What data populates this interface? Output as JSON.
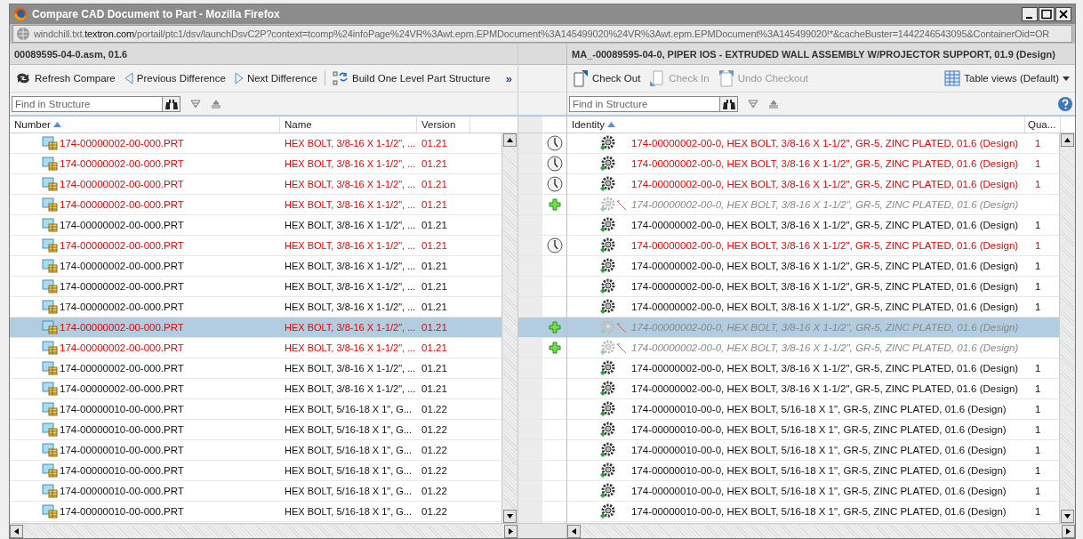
{
  "window": {
    "title": "Compare CAD Document to Part - Mozilla Firefox"
  },
  "address_bar": {
    "url_prefix": "windchill.txt.",
    "url_host": "textron.com",
    "url_rest": "/portail/ptc1/dsv/launchDsvC2P?context=tcomp%24infoPage%24VR%3Awt.epm.EPMDocument%3A145499020%24VR%3Awt.epm.EPMDocument%3A145499020!*&cacheBuster=1442246543095&ContainerOid=OR"
  },
  "left_pane": {
    "title": "00089595-04-0.asm, 01.6",
    "toolbar": [
      {
        "kind": "refresh",
        "label": "Refresh Compare"
      },
      {
        "kind": "previous",
        "label": "Previous Difference"
      },
      {
        "kind": "next",
        "label": "Next Difference"
      },
      {
        "kind": "build",
        "label": "Build One Level Part Structure"
      }
    ],
    "overflow": "»",
    "search": {
      "placeholder": "Find in Structure"
    },
    "columns": [
      {
        "label": "Number",
        "sorted": true
      },
      {
        "label": "Name",
        "sorted": false
      },
      {
        "label": "Version",
        "sorted": false
      }
    ]
  },
  "right_pane": {
    "title": "MA_-00089595-04-0, PIPER IOS - EXTRUDED WALL ASSEMBLY W/PROJECTOR SUPPORT, 01.9 (Design)",
    "toolbar": [
      {
        "kind": "checkout",
        "label": "Check Out",
        "disabled": false
      },
      {
        "kind": "checkin",
        "label": "Check In",
        "disabled": true
      },
      {
        "kind": "undo",
        "label": "Undo Checkout",
        "disabled": true
      }
    ],
    "table_views": "Table views (Default)",
    "search": {
      "placeholder": "Find in Structure"
    },
    "columns": [
      {
        "label": "Identity",
        "sorted": true
      },
      {
        "label": "Qua...",
        "sorted": false
      }
    ]
  },
  "rows": [
    {
      "selected": false,
      "compare": {
        "kind": "modified"
      },
      "left": {
        "number": "174-00000002-00-000.PRT",
        "name": "HEX BOLT, 3/8-16 X 1-1/2\", ...",
        "version": "01.21",
        "changed": true
      },
      "right": {
        "identity": "174-00000002-00-0, HEX BOLT, 3/8-16 X 1-1/2\", GR-5, ZINC PLATED, 01.6 (Design)",
        "quantity": "1",
        "changed": true,
        "missing": false
      }
    },
    {
      "selected": false,
      "compare": {
        "kind": "modified"
      },
      "left": {
        "number": "174-00000002-00-000.PRT",
        "name": "HEX BOLT, 3/8-16 X 1-1/2\", ...",
        "version": "01.21",
        "changed": true
      },
      "right": {
        "identity": "174-00000002-00-0, HEX BOLT, 3/8-16 X 1-1/2\", GR-5, ZINC PLATED, 01.6 (Design)",
        "quantity": "1",
        "changed": true,
        "missing": false
      }
    },
    {
      "selected": false,
      "compare": {
        "kind": "modified"
      },
      "left": {
        "number": "174-00000002-00-000.PRT",
        "name": "HEX BOLT, 3/8-16 X 1-1/2\", ...",
        "version": "01.21",
        "changed": true
      },
      "right": {
        "identity": "174-00000002-00-0, HEX BOLT, 3/8-16 X 1-1/2\", GR-5, ZINC PLATED, 01.6 (Design)",
        "quantity": "1",
        "changed": true,
        "missing": false
      }
    },
    {
      "selected": false,
      "compare": {
        "kind": "added"
      },
      "left": {
        "number": "174-00000002-00-000.PRT",
        "name": "HEX BOLT, 3/8-16 X 1-1/2\", ...",
        "version": "01.21",
        "changed": true
      },
      "right": {
        "identity": "174-00000002-00-0, HEX BOLT, 3/8-16 X 1-1/2\", GR-5, ZINC PLATED, 01.6 (Design)",
        "changed": false,
        "missing": true
      }
    },
    {
      "selected": false,
      "left": {
        "number": "174-00000002-00-000.PRT",
        "name": "HEX BOLT, 3/8-16 X 1-1/2\", ...",
        "version": "01.21",
        "changed": false
      },
      "right": {
        "identity": "174-00000002-00-0, HEX BOLT, 3/8-16 X 1-1/2\", GR-5, ZINC PLATED, 01.6 (Design)",
        "quantity": "1",
        "changed": false,
        "missing": false
      }
    },
    {
      "selected": false,
      "compare": {
        "kind": "modified"
      },
      "left": {
        "number": "174-00000002-00-000.PRT",
        "name": "HEX BOLT, 3/8-16 X 1-1/2\", ...",
        "version": "01.21",
        "changed": true
      },
      "right": {
        "identity": "174-00000002-00-0, HEX BOLT, 3/8-16 X 1-1/2\", GR-5, ZINC PLATED, 01.6 (Design)",
        "quantity": "1",
        "changed": true,
        "missing": false
      }
    },
    {
      "selected": false,
      "left": {
        "number": "174-00000002-00-000.PRT",
        "name": "HEX BOLT, 3/8-16 X 1-1/2\", ...",
        "version": "01.21",
        "changed": false
      },
      "right": {
        "identity": "174-00000002-00-0, HEX BOLT, 3/8-16 X 1-1/2\", GR-5, ZINC PLATED, 01.6 (Design)",
        "quantity": "1",
        "changed": false,
        "missing": false
      }
    },
    {
      "selected": false,
      "left": {
        "number": "174-00000002-00-000.PRT",
        "name": "HEX BOLT, 3/8-16 X 1-1/2\", ...",
        "version": "01.21",
        "changed": false
      },
      "right": {
        "identity": "174-00000002-00-0, HEX BOLT, 3/8-16 X 1-1/2\", GR-5, ZINC PLATED, 01.6 (Design)",
        "quantity": "1",
        "changed": false,
        "missing": false
      }
    },
    {
      "selected": false,
      "left": {
        "number": "174-00000002-00-000.PRT",
        "name": "HEX BOLT, 3/8-16 X 1-1/2\", ...",
        "version": "01.21",
        "changed": false
      },
      "right": {
        "identity": "174-00000002-00-0, HEX BOLT, 3/8-16 X 1-1/2\", GR-5, ZINC PLATED, 01.6 (Design)",
        "quantity": "1",
        "changed": false,
        "missing": false
      }
    },
    {
      "selected": true,
      "compare": {
        "kind": "added"
      },
      "left": {
        "number": "174-00000002-00-000.PRT",
        "name": "HEX BOLT, 3/8-16 X 1-1/2\", ...",
        "version": "01.21",
        "changed": true
      },
      "right": {
        "identity": "174-00000002-00-0, HEX BOLT, 3/8-16 X 1-1/2\", GR-5, ZINC PLATED, 01.6 (Design)",
        "changed": false,
        "missing": true
      }
    },
    {
      "selected": false,
      "compare": {
        "kind": "added"
      },
      "left": {
        "number": "174-00000002-00-000.PRT",
        "name": "HEX BOLT, 3/8-16 X 1-1/2\", ...",
        "version": "01.21",
        "changed": true
      },
      "right": {
        "identity": "174-00000002-00-0, HEX BOLT, 3/8-16 X 1-1/2\", GR-5, ZINC PLATED, 01.6 (Design)",
        "changed": false,
        "missing": true
      }
    },
    {
      "selected": false,
      "left": {
        "number": "174-00000002-00-000.PRT",
        "name": "HEX BOLT, 3/8-16 X 1-1/2\", ...",
        "version": "01.21",
        "changed": false
      },
      "right": {
        "identity": "174-00000002-00-0, HEX BOLT, 3/8-16 X 1-1/2\", GR-5, ZINC PLATED, 01.6 (Design)",
        "quantity": "1",
        "changed": false,
        "missing": false
      }
    },
    {
      "selected": false,
      "left": {
        "number": "174-00000002-00-000.PRT",
        "name": "HEX BOLT, 3/8-16 X 1-1/2\", ...",
        "version": "01.21",
        "changed": false
      },
      "right": {
        "identity": "174-00000002-00-0, HEX BOLT, 3/8-16 X 1-1/2\", GR-5, ZINC PLATED, 01.6 (Design)",
        "quantity": "1",
        "changed": false,
        "missing": false
      }
    },
    {
      "selected": false,
      "left": {
        "number": "174-00000010-00-000.PRT",
        "name": "HEX BOLT, 5/16-18 X 1\", G...",
        "version": "01.22",
        "changed": false
      },
      "right": {
        "identity": "174-00000010-00-0, HEX BOLT, 5/16-18 X 1\", GR-5, ZINC PLATED, 01.6 (Design)",
        "quantity": "1",
        "changed": false,
        "missing": false
      }
    },
    {
      "selected": false,
      "left": {
        "number": "174-00000010-00-000.PRT",
        "name": "HEX BOLT, 5/16-18 X 1\", G...",
        "version": "01.22",
        "changed": false
      },
      "right": {
        "identity": "174-00000010-00-0, HEX BOLT, 5/16-18 X 1\", GR-5, ZINC PLATED, 01.6 (Design)",
        "quantity": "1",
        "changed": false,
        "missing": false
      }
    },
    {
      "selected": false,
      "left": {
        "number": "174-00000010-00-000.PRT",
        "name": "HEX BOLT, 5/16-18 X 1\", G...",
        "version": "01.22",
        "changed": false
      },
      "right": {
        "identity": "174-00000010-00-0, HEX BOLT, 5/16-18 X 1\", GR-5, ZINC PLATED, 01.6 (Design)",
        "quantity": "1",
        "changed": false,
        "missing": false
      }
    },
    {
      "selected": false,
      "left": {
        "number": "174-00000010-00-000.PRT",
        "name": "HEX BOLT, 5/16-18 X 1\", G...",
        "version": "01.22",
        "changed": false
      },
      "right": {
        "identity": "174-00000010-00-0, HEX BOLT, 5/16-18 X 1\", GR-5, ZINC PLATED, 01.6 (Design)",
        "quantity": "1",
        "changed": false,
        "missing": false
      }
    },
    {
      "selected": false,
      "left": {
        "number": "174-00000010-00-000.PRT",
        "name": "HEX BOLT, 5/16-18 X 1\", G...",
        "version": "01.22",
        "changed": false
      },
      "right": {
        "identity": "174-00000010-00-0, HEX BOLT, 5/16-18 X 1\", GR-5, ZINC PLATED, 01.6 (Design)",
        "quantity": "1",
        "changed": false,
        "missing": false
      }
    },
    {
      "selected": false,
      "left": {
        "number": "174-00000010-00-000.PRT",
        "name": "HEX BOLT, 5/16-18 X 1\", G...",
        "version": "01.22",
        "changed": false
      },
      "right": {
        "identity": "174-00000010-00-0, HEX BOLT, 5/16-18 X 1\", GR-5, ZINC PLATED, 01.6 (Design)",
        "quantity": "1",
        "changed": false,
        "missing": false
      }
    }
  ]
}
